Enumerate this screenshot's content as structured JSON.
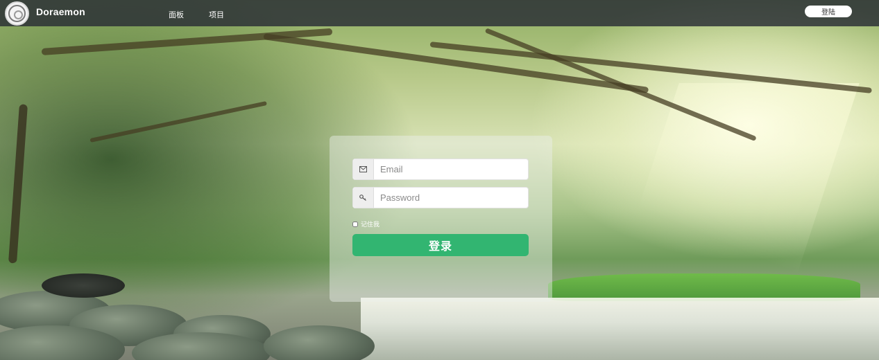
{
  "navbar": {
    "brand": "Doraemon",
    "links": [
      "面板",
      "项目"
    ],
    "login_button": "登陆"
  },
  "login_form": {
    "email": {
      "placeholder": "Email",
      "value": "",
      "icon": "envelope-icon"
    },
    "password": {
      "placeholder": "Password",
      "value": "",
      "icon": "key-icon"
    },
    "remember_label": "记住我",
    "submit_label": "登录"
  },
  "colors": {
    "navbar_bg": "#282c34",
    "submit_button": "#32b571"
  }
}
